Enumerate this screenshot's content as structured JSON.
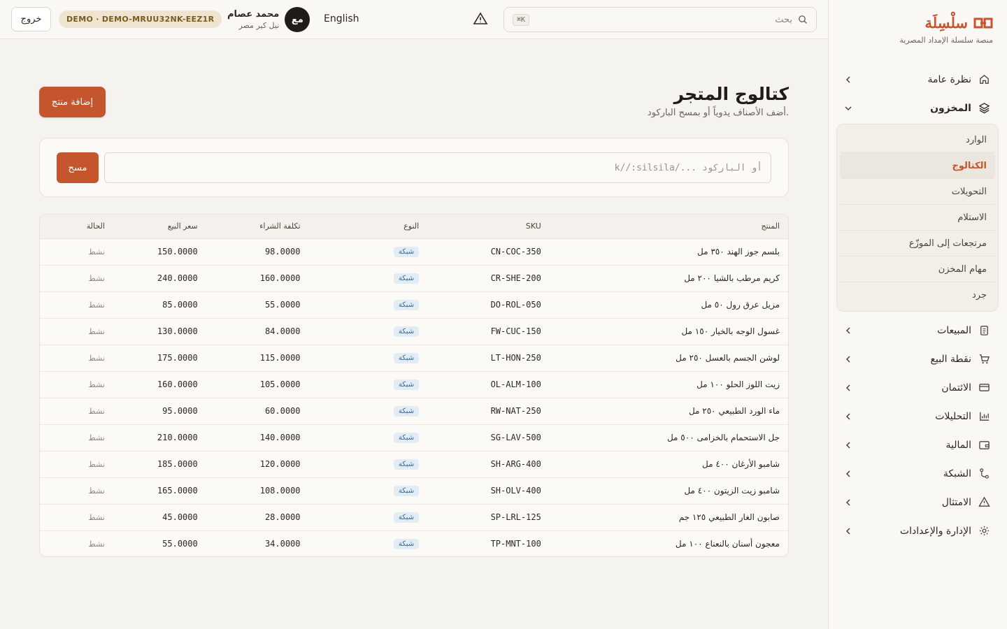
{
  "brand": {
    "name": "سلْسِلَة",
    "subtitle": "منصة سلسلة الإمداد المصرية"
  },
  "sidebar": {
    "items": [
      {
        "label": "نظرة عامة",
        "icon": "home-icon"
      },
      {
        "label": "المخزون",
        "icon": "layers-icon",
        "open": true
      },
      {
        "label": "المبيعات",
        "icon": "clipboard-icon"
      },
      {
        "label": "نقطة البيع",
        "icon": "cart-icon"
      },
      {
        "label": "الائتمان",
        "icon": "credit-card-icon"
      },
      {
        "label": "التحليلات",
        "icon": "bar-chart-icon"
      },
      {
        "label": "المالية",
        "icon": "wallet-icon"
      },
      {
        "label": "الشبكة",
        "icon": "network-icon"
      },
      {
        "label": "الامتثال",
        "icon": "warning-icon"
      },
      {
        "label": "الإدارة والإعدادات",
        "icon": "gear-icon"
      }
    ],
    "inventory_sub": [
      {
        "label": "الوارد"
      },
      {
        "label": "الكتالوج",
        "active": true
      },
      {
        "label": "التحويلات"
      },
      {
        "label": "الاستلام"
      },
      {
        "label": "مرتجعات إلى الموزّع"
      },
      {
        "label": "مهام المخزن"
      },
      {
        "label": "جرد"
      }
    ]
  },
  "header": {
    "search_placeholder": "بحث",
    "search_shortcut": "⌘K",
    "language": "English",
    "user": {
      "initials": "مع",
      "name": "محمد عصام",
      "org": "نيل كير مصر"
    },
    "demo_badge": "DEMO · DEMO-MRUU32NK-EEZ1R",
    "logout": "خروج"
  },
  "main": {
    "title": "كتالوج المتجر",
    "subtitle": "أضف الأصناف يدوياً أو بمسح الباركود.",
    "add_button": "إضافة منتج",
    "scan_placeholder": "k//:silsila/... أو الباركود",
    "scan_button": "مسح",
    "table": {
      "headers": [
        "المنتج",
        "SKU",
        "النوع",
        "تكلفة الشراء",
        "سعر البيع",
        "الحالة"
      ],
      "rows": [
        {
          "product": "بلسم جوز الهند ٣٥٠ مل",
          "sku": "CN-COC-350",
          "type": "شبكة",
          "cost": "98.0000",
          "price": "150.0000",
          "status": "نشط"
        },
        {
          "product": "كريم مرطب بالشيا ٢٠٠ مل",
          "sku": "CR-SHE-200",
          "type": "شبكة",
          "cost": "160.0000",
          "price": "240.0000",
          "status": "نشط"
        },
        {
          "product": "مزيل عرق رول ٥٠ مل",
          "sku": "DO-ROL-050",
          "type": "شبكة",
          "cost": "55.0000",
          "price": "85.0000",
          "status": "نشط"
        },
        {
          "product": "غسول الوجه بالخيار ١٥٠ مل",
          "sku": "FW-CUC-150",
          "type": "شبكة",
          "cost": "84.0000",
          "price": "130.0000",
          "status": "نشط"
        },
        {
          "product": "لوشن الجسم بالعسل ٢٥٠ مل",
          "sku": "LT-HON-250",
          "type": "شبكة",
          "cost": "115.0000",
          "price": "175.0000",
          "status": "نشط"
        },
        {
          "product": "زيت اللوز الحلو ١٠٠ مل",
          "sku": "OL-ALM-100",
          "type": "شبكة",
          "cost": "105.0000",
          "price": "160.0000",
          "status": "نشط"
        },
        {
          "product": "ماء الورد الطبيعي ٢٥٠ مل",
          "sku": "RW-NAT-250",
          "type": "شبكة",
          "cost": "60.0000",
          "price": "95.0000",
          "status": "نشط"
        },
        {
          "product": "جل الاستحمام بالخزامى ٥٠٠ مل",
          "sku": "SG-LAV-500",
          "type": "شبكة",
          "cost": "140.0000",
          "price": "210.0000",
          "status": "نشط"
        },
        {
          "product": "شامبو الأرغان ٤٠٠ مل",
          "sku": "SH-ARG-400",
          "type": "شبكة",
          "cost": "120.0000",
          "price": "185.0000",
          "status": "نشط"
        },
        {
          "product": "شامبو زيت الزيتون ٤٠٠ مل",
          "sku": "SH-OLV-400",
          "type": "شبكة",
          "cost": "108.0000",
          "price": "165.0000",
          "status": "نشط"
        },
        {
          "product": "صابون الغار الطبيعي ١٢٥ جم",
          "sku": "SP-LRL-125",
          "type": "شبكة",
          "cost": "28.0000",
          "price": "45.0000",
          "status": "نشط"
        },
        {
          "product": "معجون أسنان بالنعناع ١٠٠ مل",
          "sku": "TP-MNT-100",
          "type": "شبكة",
          "cost": "34.0000",
          "price": "55.0000",
          "status": "نشط"
        }
      ]
    }
  },
  "colors": {
    "accent": "#c4552c",
    "background": "#f5f3ef",
    "sidebar": "#faf8f5",
    "type_pill_bg": "#e2ecf5",
    "type_pill_text": "#3b6a93",
    "demo_badge_bg": "#efe4cf"
  }
}
